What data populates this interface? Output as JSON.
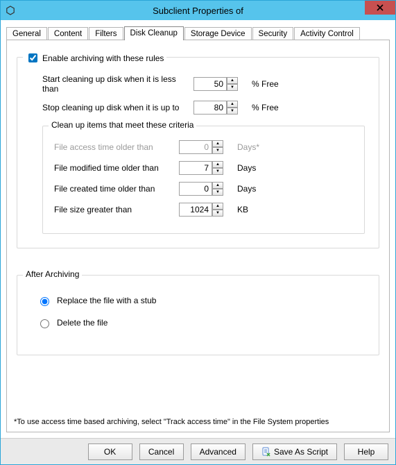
{
  "window": {
    "title": "Subclient Properties of"
  },
  "tabs": {
    "general": "General",
    "content": "Content",
    "filters": "Filters",
    "disk_cleanup": "Disk Cleanup",
    "storage_device": "Storage Device",
    "security": "Security",
    "activity_control": "Activity Control"
  },
  "enable_group": {
    "checkbox_label": "Enable archiving with these rules",
    "start_label": "Start cleaning up disk when it is less than",
    "start_value": "50",
    "start_unit": "% Free",
    "stop_label": "Stop cleaning up disk when it is up to",
    "stop_value": "80",
    "stop_unit": "% Free"
  },
  "criteria": {
    "legend": "Clean up items that meet these criteria",
    "access_label": "File access time older than",
    "access_value": "0",
    "access_unit": "Days*",
    "modified_label": "File modified time older than",
    "modified_value": "7",
    "modified_unit": "Days",
    "created_label": "File created time older than",
    "created_value": "0",
    "created_unit": "Days",
    "size_label": "File size greater than",
    "size_value": "1024",
    "size_unit": "KB"
  },
  "after": {
    "legend": "After Archiving",
    "replace_label": "Replace the file with a stub",
    "delete_label": "Delete the file"
  },
  "footnote": "*To use access time based archiving, select \"Track access time\" in the File System properties",
  "buttons": {
    "ok": "OK",
    "cancel": "Cancel",
    "advanced": "Advanced",
    "save_as_script": "Save As Script",
    "help": "Help"
  }
}
